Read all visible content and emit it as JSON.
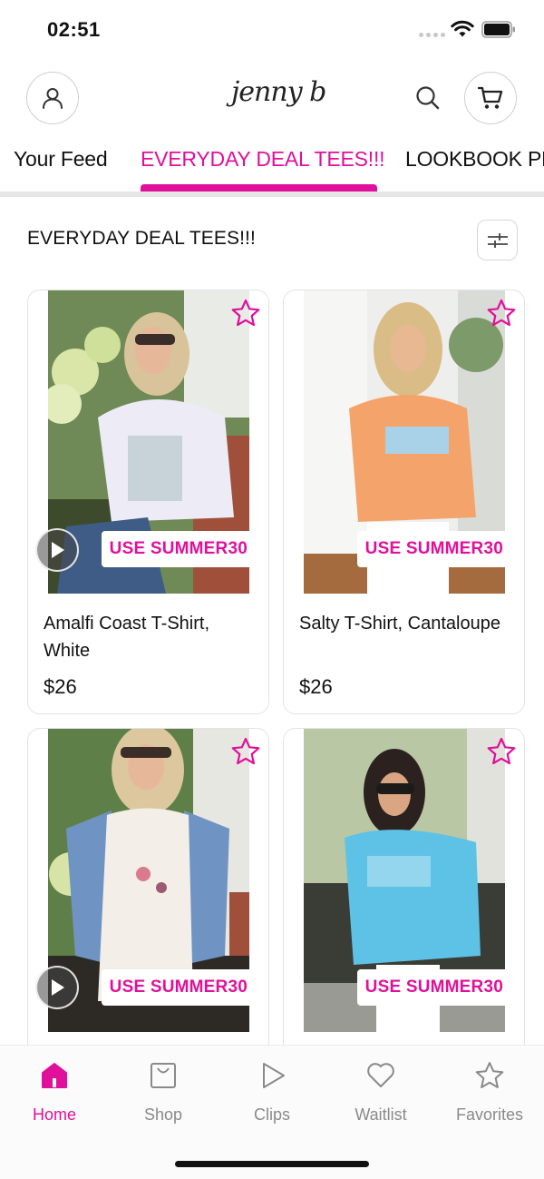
{
  "status_bar": {
    "time": "02:51"
  },
  "header": {
    "brand": "jenny b"
  },
  "tabs": [
    {
      "label": "Your Feed"
    },
    {
      "label": "EVERYDAY DEAL TEES!!!"
    },
    {
      "label": "LOOKBOOK PR"
    }
  ],
  "section": {
    "title": "EVERYDAY DEAL TEES!!!"
  },
  "products": [
    {
      "title": "Amalfi Coast T-Shirt, White",
      "price": "$26",
      "promo": "USE SUMMER30",
      "has_video": true
    },
    {
      "title": "Salty T-Shirt, Cantaloupe",
      "price": "$26",
      "promo": "USE SUMMER30",
      "has_video": false
    },
    {
      "title": "",
      "price": "",
      "promo": "USE SUMMER30",
      "has_video": true
    },
    {
      "title": "",
      "price": "",
      "promo": "USE SUMMER30",
      "has_video": false
    }
  ],
  "bottom_nav": [
    {
      "label": "Home",
      "icon": "home-icon",
      "active": true
    },
    {
      "label": "Shop",
      "icon": "shopping-bag-icon",
      "active": false
    },
    {
      "label": "Clips",
      "icon": "play-icon",
      "active": false
    },
    {
      "label": "Waitlist",
      "icon": "heart-icon",
      "active": false
    },
    {
      "label": "Favorites",
      "icon": "star-icon",
      "active": false
    }
  ],
  "colors": {
    "accent": "#e0109b",
    "muted": "#8a8a8a",
    "divider": "#e6e6e6"
  }
}
